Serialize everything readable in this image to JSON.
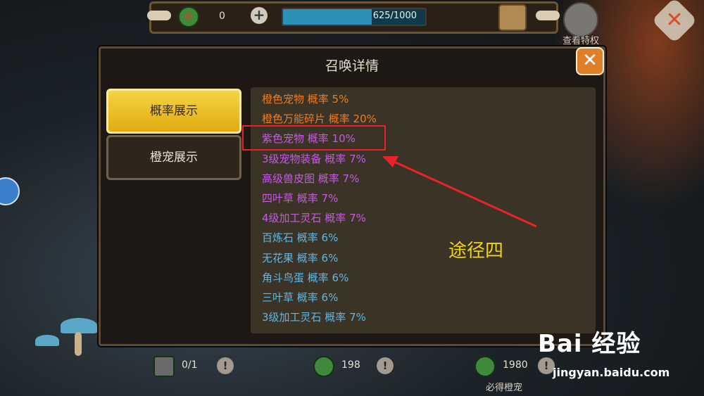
{
  "topbar": {
    "resource_count": "0",
    "plus_label": "+",
    "progress_text": "625/1000",
    "progress_fraction": 0.625,
    "privilege_label": "查看特权",
    "close_label": "✕"
  },
  "dialog": {
    "title": "召唤详情",
    "close_label": "✕",
    "tabs": [
      {
        "label": "概率展示",
        "active": true
      },
      {
        "label": "橙宠展示",
        "active": false
      }
    ],
    "rows": [
      {
        "text": "橙色宠物 概率 5%",
        "color": "orange"
      },
      {
        "text": "橙色万能碎片 概率 20%",
        "color": "orange"
      },
      {
        "text": "紫色宠物 概率 10%",
        "color": "purple"
      },
      {
        "text": "3级宠物装备 概率 7%",
        "color": "purple"
      },
      {
        "text": "高级兽皮图 概率 7%",
        "color": "purple"
      },
      {
        "text": "四叶草 概率 7%",
        "color": "purple"
      },
      {
        "text": "4级加工灵石 概率 7%",
        "color": "purple"
      },
      {
        "text": "百炼石 概率 6%",
        "color": "blue"
      },
      {
        "text": "无花果 概率 6%",
        "color": "blue"
      },
      {
        "text": "角斗鸟蛋 概率 6%",
        "color": "blue"
      },
      {
        "text": "三叶草 概率 6%",
        "color": "blue"
      },
      {
        "text": "3级加工灵石 概率 7%",
        "color": "blue"
      }
    ]
  },
  "annotation": {
    "label": "途径四",
    "color": "#f2d21a",
    "box_color": "#e8242a"
  },
  "bottom": {
    "items": [
      {
        "count": "0/1",
        "info": "!"
      },
      {
        "count": "198",
        "info": "!"
      },
      {
        "count": "1980",
        "info": "!"
      }
    ],
    "must_label": "必得橙宠"
  },
  "watermark": {
    "logo": "Bai 经验",
    "url": "jingyan.baidu.com"
  },
  "colors": {
    "orange": "#f07b1e",
    "purple": "#c45be0",
    "blue": "#5db8e8",
    "tab_active": "#f0c22a"
  }
}
